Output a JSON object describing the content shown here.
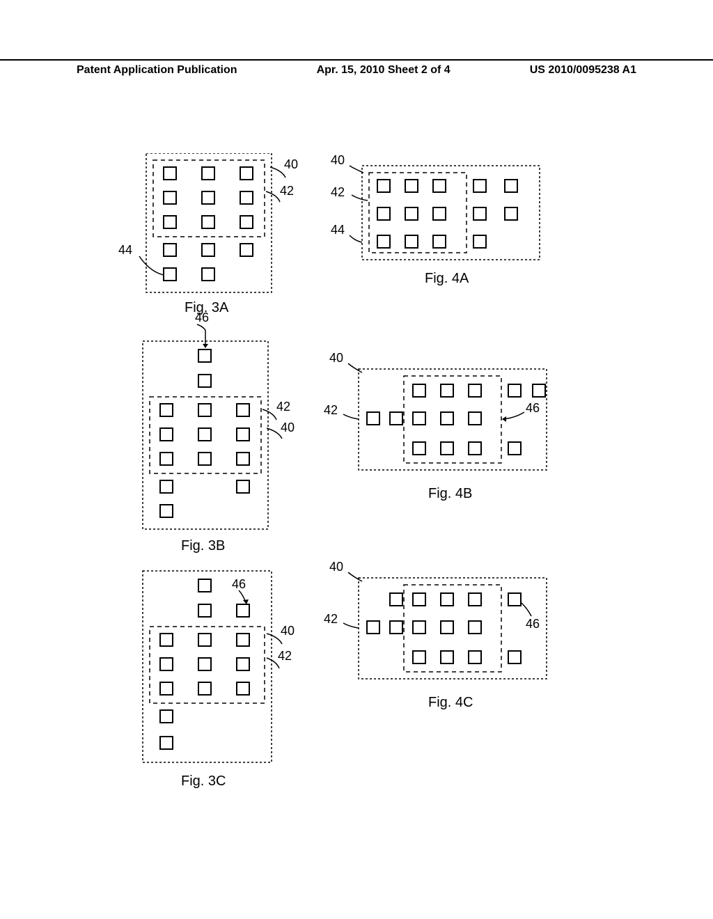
{
  "header": {
    "left": "Patent Application Publication",
    "center": "Apr. 15, 2010  Sheet 2 of 4",
    "right": "US 2010/0095238 A1"
  },
  "labels": {
    "ref40": "40",
    "ref42": "42",
    "ref44": "44",
    "ref46": "46"
  },
  "figures": {
    "f3a": "Fig. 3A",
    "f3b": "Fig. 3B",
    "f3c": "Fig. 3C",
    "f4a": "Fig. 4A",
    "f4b": "Fig. 4B",
    "f4c": "Fig. 4C"
  },
  "chart_data": [
    {
      "id": "3A",
      "type": "diagram",
      "icons_grid": [
        [
          1,
          1,
          1
        ],
        [
          1,
          1,
          1
        ],
        [
          1,
          1,
          1
        ],
        [
          1,
          1,
          1
        ],
        [
          1,
          1,
          0
        ]
      ],
      "inner_rect_rows": [
        0,
        2
      ],
      "refs": {
        "40": "outer-upper",
        "42": "inner",
        "44": "icon-row4-col1-leader"
      }
    },
    {
      "id": "3B",
      "type": "diagram",
      "icons_grid": [
        [
          0,
          1,
          0
        ],
        [
          0,
          1,
          0
        ],
        [
          1,
          1,
          1
        ],
        [
          1,
          1,
          1
        ],
        [
          1,
          1,
          1
        ],
        [
          1,
          0,
          1
        ],
        [
          1,
          0,
          0
        ]
      ],
      "inner_rect_rows": [
        2,
        4
      ],
      "refs": {
        "40": "middle",
        "42": "inner",
        "46": "top-icon-row0"
      }
    },
    {
      "id": "3C",
      "type": "diagram",
      "icons_grid": [
        [
          0,
          1,
          0
        ],
        [
          0,
          1,
          1
        ],
        [
          1,
          1,
          1
        ],
        [
          1,
          1,
          1
        ],
        [
          1,
          1,
          1
        ],
        [
          1,
          0,
          0
        ],
        [
          1,
          0,
          0
        ]
      ],
      "inner_rect_rows": [
        2,
        4
      ],
      "refs": {
        "40": "middle",
        "42": "inner",
        "46": "icon-row1-col2"
      }
    },
    {
      "id": "4A",
      "type": "diagram",
      "icons_grid": [
        [
          1,
          1,
          1,
          1,
          1
        ],
        [
          1,
          1,
          1,
          1,
          1
        ],
        [
          1,
          1,
          1,
          1,
          0
        ]
      ],
      "inner_rect_cols": [
        0,
        2
      ],
      "refs": {
        "40": "outer",
        "42": "inner",
        "44": "row2-left"
      }
    },
    {
      "id": "4B",
      "type": "diagram",
      "icons_grid": [
        [
          0,
          1,
          1,
          1,
          1,
          1
        ],
        [
          1,
          1,
          1,
          1,
          1,
          0
        ],
        [
          0,
          1,
          1,
          1,
          1,
          0
        ]
      ],
      "inner_rect_cols_offset": true,
      "refs": {
        "40": "outer",
        "42": "inner",
        "46": "row1-right"
      }
    },
    {
      "id": "4C",
      "type": "diagram",
      "icons_grid": [
        [
          0,
          1,
          1,
          1,
          1,
          1
        ],
        [
          1,
          1,
          1,
          1,
          1,
          0
        ],
        [
          0,
          1,
          1,
          1,
          1,
          0
        ]
      ],
      "inner_rect_cols_offset": true,
      "refs": {
        "40": "outer",
        "42": "inner",
        "46": "icon-row0-col4"
      }
    }
  ]
}
